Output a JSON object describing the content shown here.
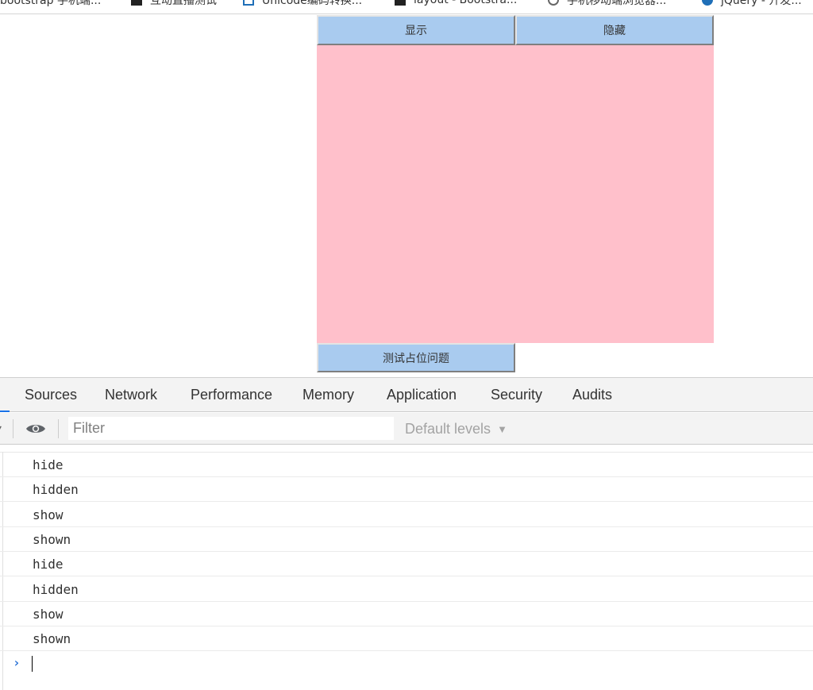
{
  "bookmarks": [
    {
      "label": "bootstrap 手机端..."
    },
    {
      "label": "互动直播测试"
    },
    {
      "label": "Unicode编码转换..."
    },
    {
      "label": "layout - Bootstra..."
    },
    {
      "label": "手机移动端浏览器..."
    },
    {
      "label": "jQuery - 开发..."
    }
  ],
  "page": {
    "show_button": "显示",
    "hide_button": "隐藏",
    "test_button": "测试占位问题",
    "box_color": "#ffc0cb",
    "button_color": "#a9cbef"
  },
  "devtools": {
    "tabs": [
      "Sources",
      "Network",
      "Performance",
      "Memory",
      "Application",
      "Security",
      "Audits"
    ],
    "filter_placeholder": "Filter",
    "levels_label": "Default levels",
    "accent_color": "#1a73e8",
    "console_logs": [
      "hide",
      "hidden",
      "show",
      "shown",
      "hide",
      "hidden",
      "show",
      "shown"
    ],
    "prompt_symbol": "›"
  }
}
